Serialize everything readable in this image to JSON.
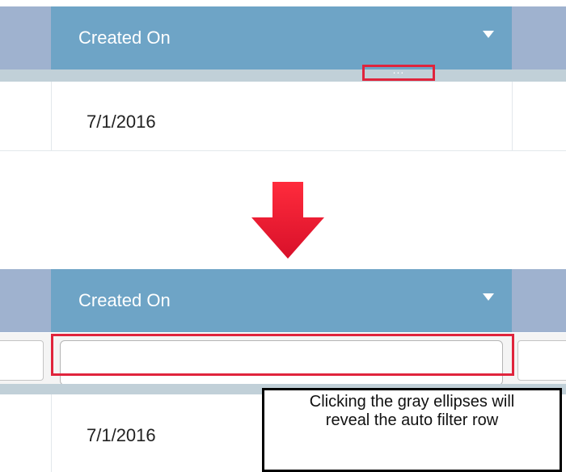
{
  "top_grid": {
    "column_header": "Created On",
    "ellipsis": "...",
    "row_value": "7/1/2016"
  },
  "bottom_grid": {
    "column_header": "Created On",
    "filter_input": {
      "value": "",
      "placeholder": ""
    },
    "row_value": "7/1/2016"
  },
  "annotation": {
    "line1": "Clicking the gray ellipses will",
    "line2": "reveal the auto filter row"
  },
  "icons": {
    "dropdown": "chevron-down-icon",
    "transition": "arrow-down-icon"
  },
  "colors": {
    "header_blue": "#6ea4c6",
    "header_side": "#9fb2cf",
    "highlight_red": "#e0243c",
    "strip_gray": "#c1d0d8"
  }
}
